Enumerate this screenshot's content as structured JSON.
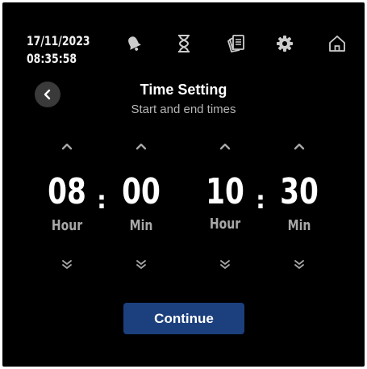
{
  "status": {
    "date": "17/11/2023",
    "time": "08:35:58"
  },
  "header": {
    "title": "Time Setting",
    "subtitle": "Start and end times"
  },
  "start": {
    "hour": "08",
    "minute": "00",
    "hour_label": "Hour",
    "minute_label": "Min"
  },
  "end": {
    "hour": "10",
    "minute": "30",
    "hour_label": "Hour",
    "minute_label": "Min"
  },
  "separator": ":",
  "continue_label": "Continue",
  "colors": {
    "background": "#000000",
    "button": "#1c3f7d",
    "muted": "#a7a7a7",
    "icon": "#cccccc"
  },
  "icons": [
    "bell-icon",
    "hourglass-icon",
    "documents-icon",
    "gear-icon",
    "home-icon"
  ]
}
